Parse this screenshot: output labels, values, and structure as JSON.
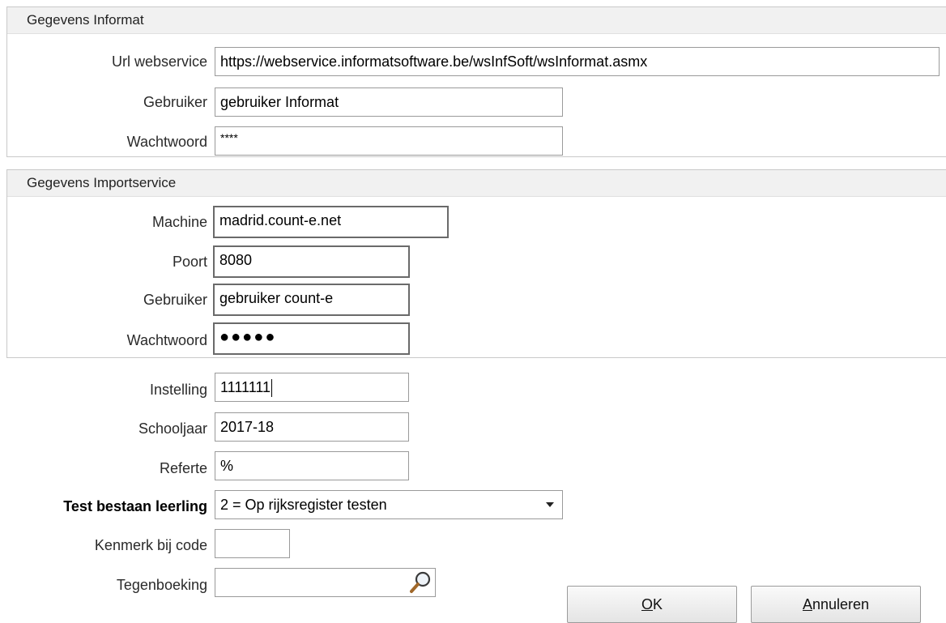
{
  "informat": {
    "title": "Gegevens Informat",
    "url_label": "Url webservice",
    "url_value": "https://webservice.informatsoftware.be/wsInfSoft/wsInformat.asmx",
    "user_label": "Gebruiker",
    "user_value": "gebruiker Informat",
    "password_label": "Wachtwoord",
    "password_value": "****"
  },
  "importservice": {
    "title": "Gegevens Importservice",
    "machine_label": "Machine",
    "machine_value": "madrid.count-e.net",
    "port_label": "Poort",
    "port_value": "8080",
    "user_label": "Gebruiker",
    "user_value": "gebruiker count-e",
    "password_label": "Wachtwoord",
    "password_value": "●●●●●"
  },
  "settings": {
    "instelling_label": "Instelling",
    "instelling_value": "1111111",
    "schooljaar_label": "Schooljaar",
    "schooljaar_value": "2017-18",
    "referte_label": "Referte",
    "referte_value": "%",
    "test_label": "Test bestaan leerling",
    "test_value": "2 = Op rijksregister testen",
    "kenmerk_label": "Kenmerk bij code",
    "kenmerk_value": "",
    "tegenboeking_label": "Tegenboeking",
    "tegenboeking_value": ""
  },
  "buttons": {
    "ok_mnemonic": "O",
    "ok_rest": "K",
    "cancel_mnemonic": "A",
    "cancel_rest": "nnuleren"
  },
  "icons": {
    "search": "search-icon",
    "dropdown": "chevron-down-icon"
  }
}
